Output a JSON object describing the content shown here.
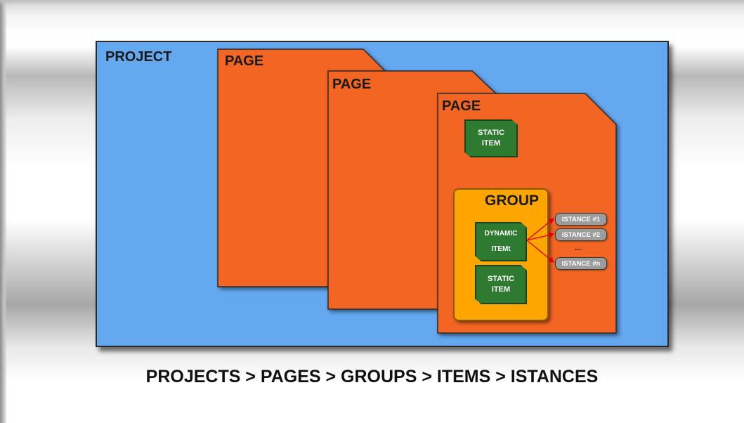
{
  "project": {
    "label": "PROJECT"
  },
  "pages": [
    {
      "label": "PAGE"
    },
    {
      "label": "PAGE"
    },
    {
      "label": "PAGE"
    }
  ],
  "group": {
    "label": "GROUP"
  },
  "items": {
    "page_static": {
      "line1": "STATIC",
      "line2": "ITEM"
    },
    "dynamic": {
      "line1": "DYNAMIC",
      "line2": "ITEMt"
    },
    "group_static": {
      "line1": "STATIC",
      "line2": "ITEM"
    }
  },
  "instances": [
    "ISTANCE #1",
    "ISTANCE #2",
    "...",
    "ISTANCE #n"
  ],
  "caption": "PROJECTS > PAGES > GROUPS > ITEMS > ISTANCES",
  "colors": {
    "project": "#64a8f0",
    "page": "#f26522",
    "group": "#ffa500",
    "item": "#2d7a30",
    "instance": "#9c9c9c",
    "connector": "#e00000"
  }
}
